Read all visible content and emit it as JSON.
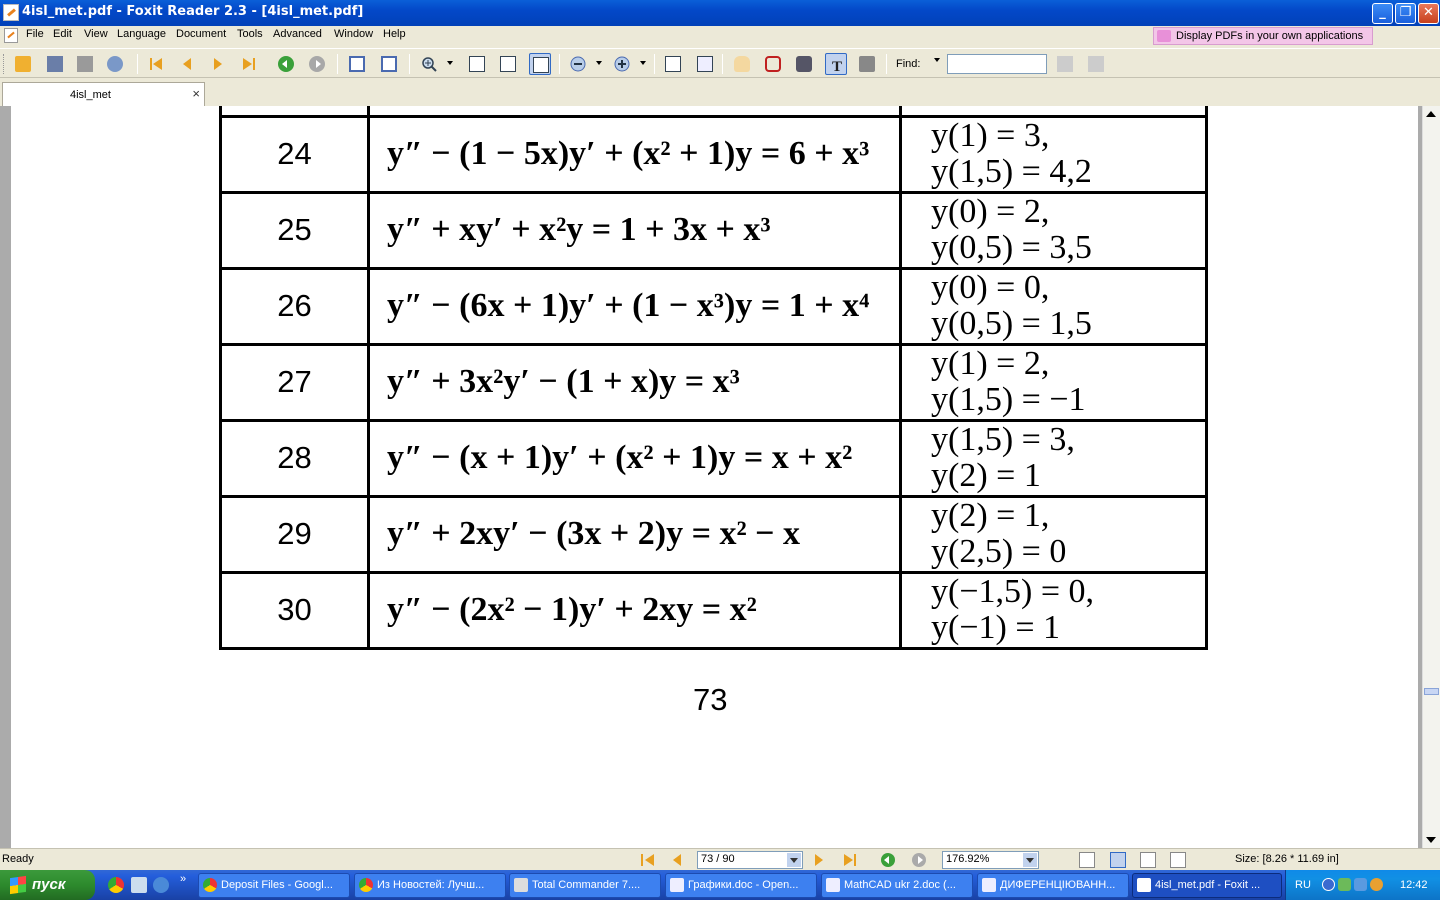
{
  "window": {
    "title": "4isl_met.pdf - Foxit Reader 2.3 - [4isl_met.pdf]",
    "minimize": "_",
    "restore": "❐",
    "close": "✕"
  },
  "menu": {
    "items": [
      "File",
      "Edit",
      "View",
      "Language",
      "Document",
      "Tools",
      "Advanced",
      "Window",
      "Help"
    ],
    "promo": "Display PDFs in your own applications"
  },
  "toolbar": {
    "find_label": "Find:",
    "find_value": ""
  },
  "tabs": [
    {
      "label": "4isl_met",
      "close": "×"
    }
  ],
  "document": {
    "rows": [
      {
        "num": "24",
        "eq": "y″ − (1 − 5x)y′ + (x² + 1)y = 6 + x³",
        "c1": "y(1) = 3,",
        "c2": "y(1,5) = 4,2"
      },
      {
        "num": "25",
        "eq": "y″ + xy′ + x²y = 1 + 3x + x³",
        "c1": "y(0) = 2,",
        "c2": "y(0,5) = 3,5"
      },
      {
        "num": "26",
        "eq": "y″ − (6x + 1)y′ + (1 − x³)y = 1 + x⁴",
        "c1": "y(0) = 0,",
        "c2": "y(0,5) = 1,5"
      },
      {
        "num": "27",
        "eq": "y″ + 3x²y′ − (1 + x)y = x³",
        "c1": "y(1) = 2,",
        "c2": "y(1,5) = −1"
      },
      {
        "num": "28",
        "eq": "y″ − (x + 1)y′ + (x² + 1)y = x + x²",
        "c1": "y(1,5) = 3,",
        "c2": "y(2) = 1"
      },
      {
        "num": "29",
        "eq": "y″ + 2xy′ − (3x + 2)y = x² − x",
        "c1": "y(2) = 1,",
        "c2": "y(2,5) = 0"
      },
      {
        "num": "30",
        "eq": "y″ − (2x² − 1)y′ + 2xy = x²",
        "c1": "y(−1,5) = 0,",
        "c2": "y(−1) = 1"
      }
    ],
    "page_number": "73"
  },
  "status": {
    "ready": "Ready",
    "page": "73 / 90",
    "zoom": "176.92%",
    "size": "Size: [8.26 * 11.69 in]"
  },
  "taskbar": {
    "start": "пуск",
    "tasks": [
      "Deposit Files - Googl...",
      "Из Новостей: Лучш...",
      "Total Commander 7....",
      "Графики.doc - Open...",
      "MathCAD ukr 2.doc (...",
      "ДИФЕРЕНЦІЮВАНН...",
      "4isl_met.pdf - Foxit ..."
    ],
    "active_task": 6,
    "lang": "RU",
    "clock": "12:42"
  }
}
